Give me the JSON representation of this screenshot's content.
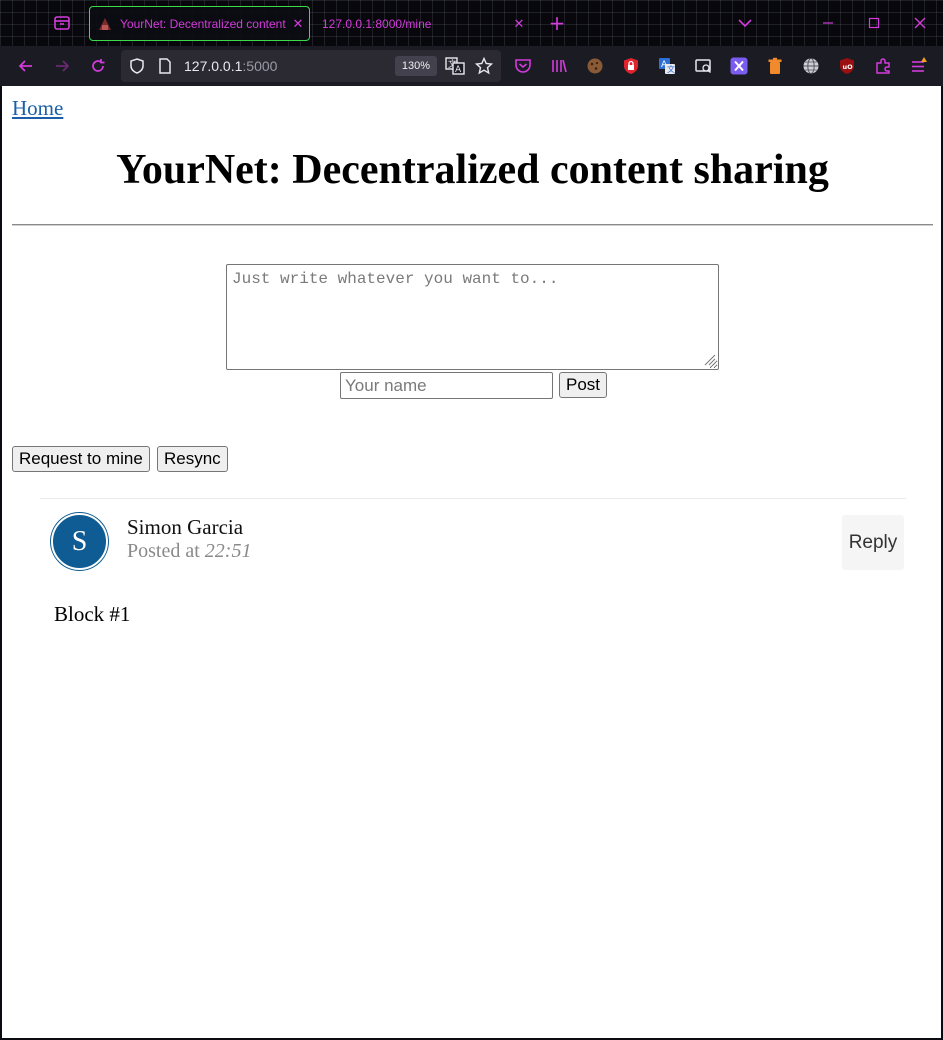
{
  "browser": {
    "tabs": [
      {
        "title": "YourNet: Decentralized content sharing",
        "active": true
      },
      {
        "title": "127.0.0.1:8000/mine",
        "active": false
      }
    ],
    "url_host": "127.0.0.1",
    "url_port": ":5000",
    "zoom": "130%",
    "accent_color": "#d43bdc",
    "active_tab_border": "#3bdc4a",
    "extensions": [
      "pocket-icon",
      "library-icon",
      "cookie-icon",
      "lock-shield-icon",
      "translate-icon",
      "screenshot-icon",
      "x-extension-icon",
      "trash-icon",
      "globe-icon",
      "ublock-icon",
      "puzzle-icon",
      "menu-icon"
    ]
  },
  "page": {
    "home_link": "Home",
    "title": "YourNet: Decentralized content sharing",
    "compose": {
      "text_placeholder": "Just write whatever you want to...",
      "name_placeholder": "Your name",
      "post_label": "Post"
    },
    "actions": {
      "mine_label": "Request to mine",
      "resync_label": "Resync"
    },
    "posts": [
      {
        "avatar_letter": "S",
        "author": "Simon Garcia",
        "posted_prefix": "Posted at",
        "time": "22:51",
        "reply_label": "Reply",
        "content": "Block #1",
        "avatar_color": "#0e5c93"
      }
    ]
  }
}
